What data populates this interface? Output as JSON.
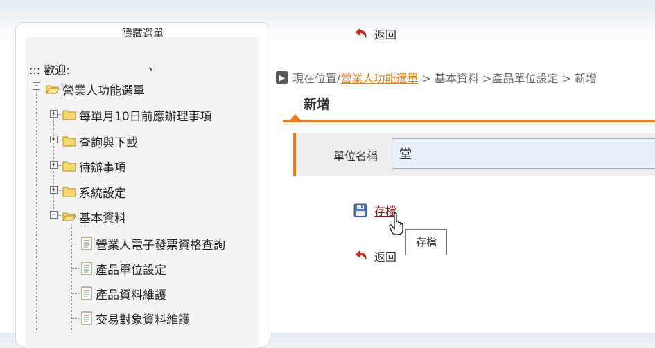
{
  "sidebar": {
    "hide_menu": "隱藏選單",
    "welcome": "::: 歡迎:",
    "welcome_mark": "、",
    "root": {
      "label": "營業人功能選單",
      "expanded": true
    },
    "items": [
      {
        "label": "每單月10日前應辦理事項",
        "expanded": false
      },
      {
        "label": "查詢與下載",
        "expanded": false
      },
      {
        "label": "待辦事項",
        "expanded": false
      },
      {
        "label": "系統設定",
        "expanded": false
      },
      {
        "label": "基本資料",
        "expanded": true
      }
    ],
    "sub_items": [
      "營業人電子發票資格查詢",
      "產品單位設定",
      "產品資料維護",
      "交易對象資料維護"
    ]
  },
  "top_back_label": "返回",
  "breadcrumb": {
    "prefix": "現在位置",
    "separator": "/",
    "link": "營業人功能選單",
    "rest": " > 基本資料 >產品單位設定 > 新增"
  },
  "page_title": "新增",
  "form": {
    "label": "單位名稱",
    "value": "堂"
  },
  "save_label": "存檔",
  "tooltip": "存檔",
  "bottom_back_label": "返回",
  "colors": {
    "accent": "#ee7a1e",
    "link_orange": "#e67e22",
    "save_link": "#8b1a1a",
    "input_bg": "#e8f0fd"
  },
  "icons": {
    "back": "red-curved-arrow-icon",
    "breadcrumb": "arrow-right-box-icon",
    "save": "floppy-disk-icon",
    "folder_open": "folder-open-icon",
    "folder_closed": "folder-icon",
    "document": "document-icon"
  }
}
